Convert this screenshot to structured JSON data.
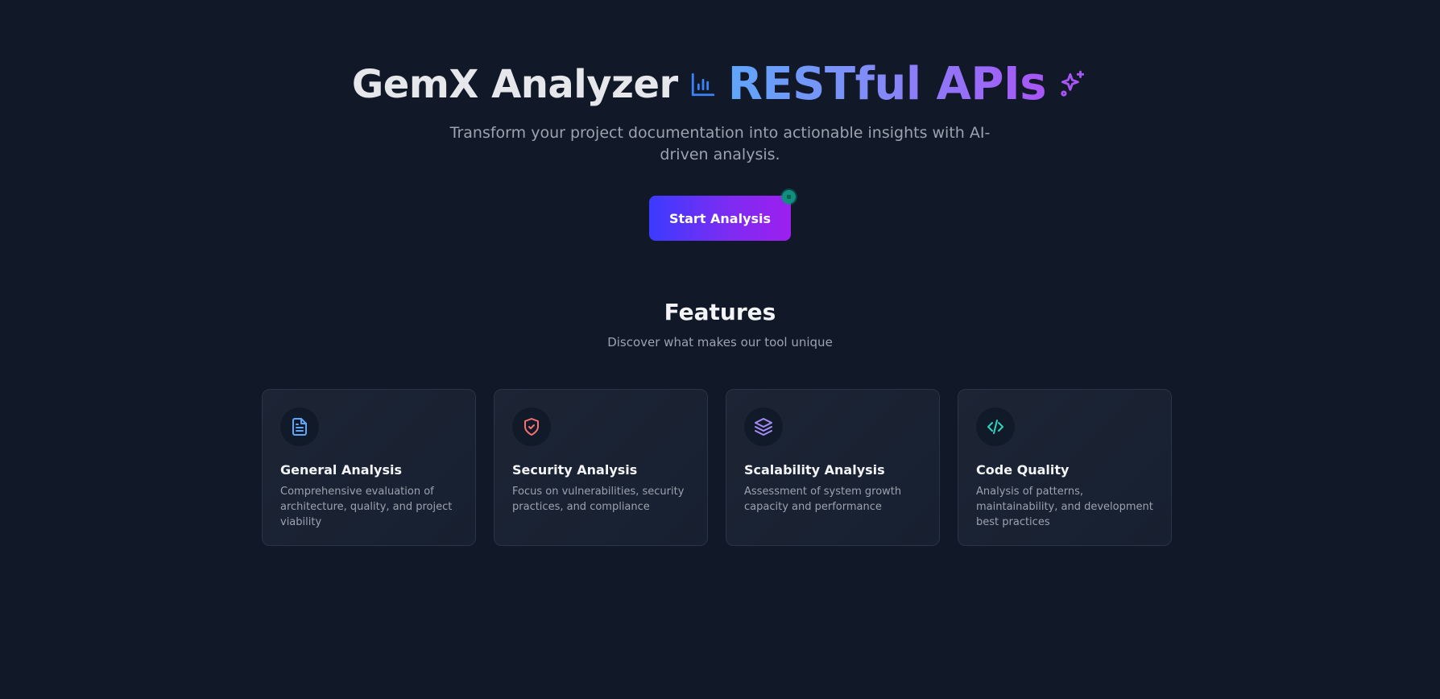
{
  "hero": {
    "title_main": "GemX Analyzer",
    "title_accent": "RESTful APIs",
    "subtitle": "Transform your project documentation into actionable insights with AI-driven analysis.",
    "cta_label": "Start Analysis"
  },
  "icons": {
    "title_chart": "bar-chart-icon",
    "title_sparkle": "sparkles-icon"
  },
  "features": {
    "title": "Features",
    "subtitle": "Discover what makes our tool unique",
    "cards": [
      {
        "icon": "document-icon",
        "icon_color": "#60a5fa",
        "title": "General Analysis",
        "description": "Comprehensive evaluation of architecture, quality, and project viability"
      },
      {
        "icon": "shield-check-icon",
        "icon_color": "#f87171",
        "title": "Security Analysis",
        "description": "Focus on vulnerabilities, security practices, and compliance"
      },
      {
        "icon": "layers-icon",
        "icon_color": "#a78bfa",
        "title": "Scalability Analysis",
        "description": "Assessment of system growth capacity and performance"
      },
      {
        "icon": "code-icon",
        "icon_color": "#2dd4bf",
        "title": "Code Quality",
        "description": "Analysis of patterns, maintainability, and development best practices"
      }
    ]
  },
  "colors": {
    "background": "#111827",
    "accent_start": "#3b3bff",
    "accent_end": "#9d1ff0"
  }
}
